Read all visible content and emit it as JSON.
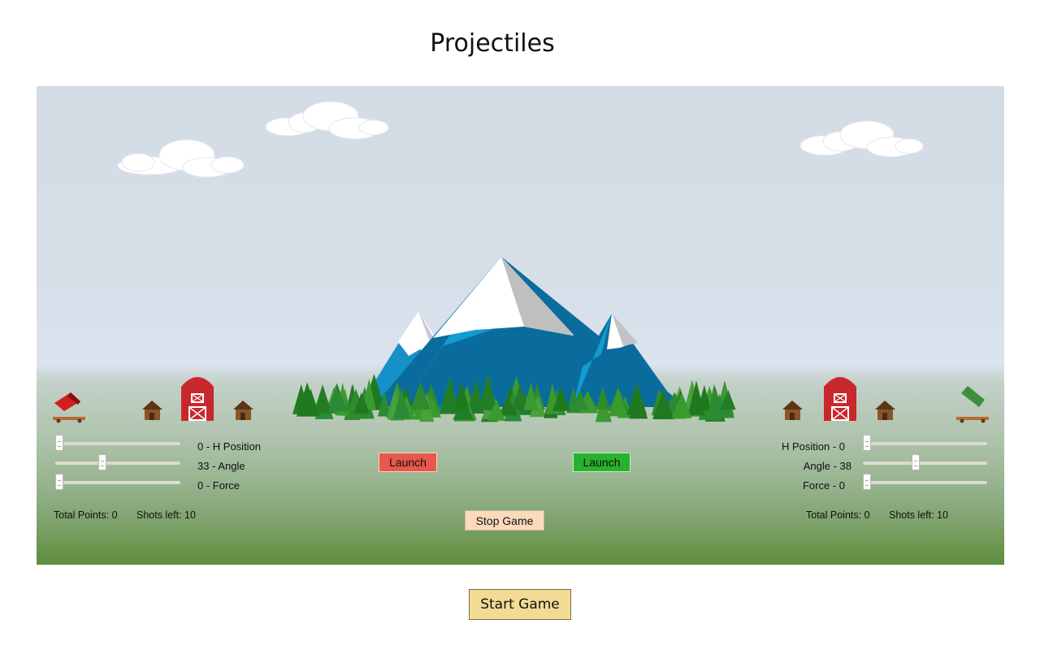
{
  "title": "Projectiles",
  "player_left": {
    "h_position": {
      "value": 0,
      "label": "0 - H Position",
      "min": 0,
      "max": 100
    },
    "angle": {
      "value": 33,
      "label": "33 - Angle",
      "min": 0,
      "max": 90
    },
    "force": {
      "value": 0,
      "label": "0 - Force",
      "min": 0,
      "max": 100
    },
    "launch_label": "Launch",
    "total_points_text": "Total Points: 0",
    "shots_left_text": "Shots left: 10",
    "cannon_color": "#d11f1f"
  },
  "player_right": {
    "h_position": {
      "value": 0,
      "label": "H Position - 0",
      "min": 0,
      "max": 100
    },
    "angle": {
      "value": 38,
      "label": "Angle - 38",
      "min": 0,
      "max": 90
    },
    "force": {
      "value": 0,
      "label": "Force - 0",
      "min": 0,
      "max": 100
    },
    "launch_label": "Launch",
    "total_points_text": "Total Points: 0",
    "shots_left_text": "Shots left: 10",
    "cannon_color": "#3f8f3a"
  },
  "stop_game_label": "Stop Game",
  "start_game_label": "Start Game",
  "colors": {
    "launch_left": "#e8574b",
    "launch_right": "#27b22e",
    "stop_button": "#fbd9bb",
    "start_button": "#f2dc95",
    "barn": "#c8282d"
  },
  "icons": [
    "cloud-icon",
    "mountain-icon",
    "tree-icon",
    "barn-icon",
    "cabin-icon",
    "cannon-icon"
  ]
}
